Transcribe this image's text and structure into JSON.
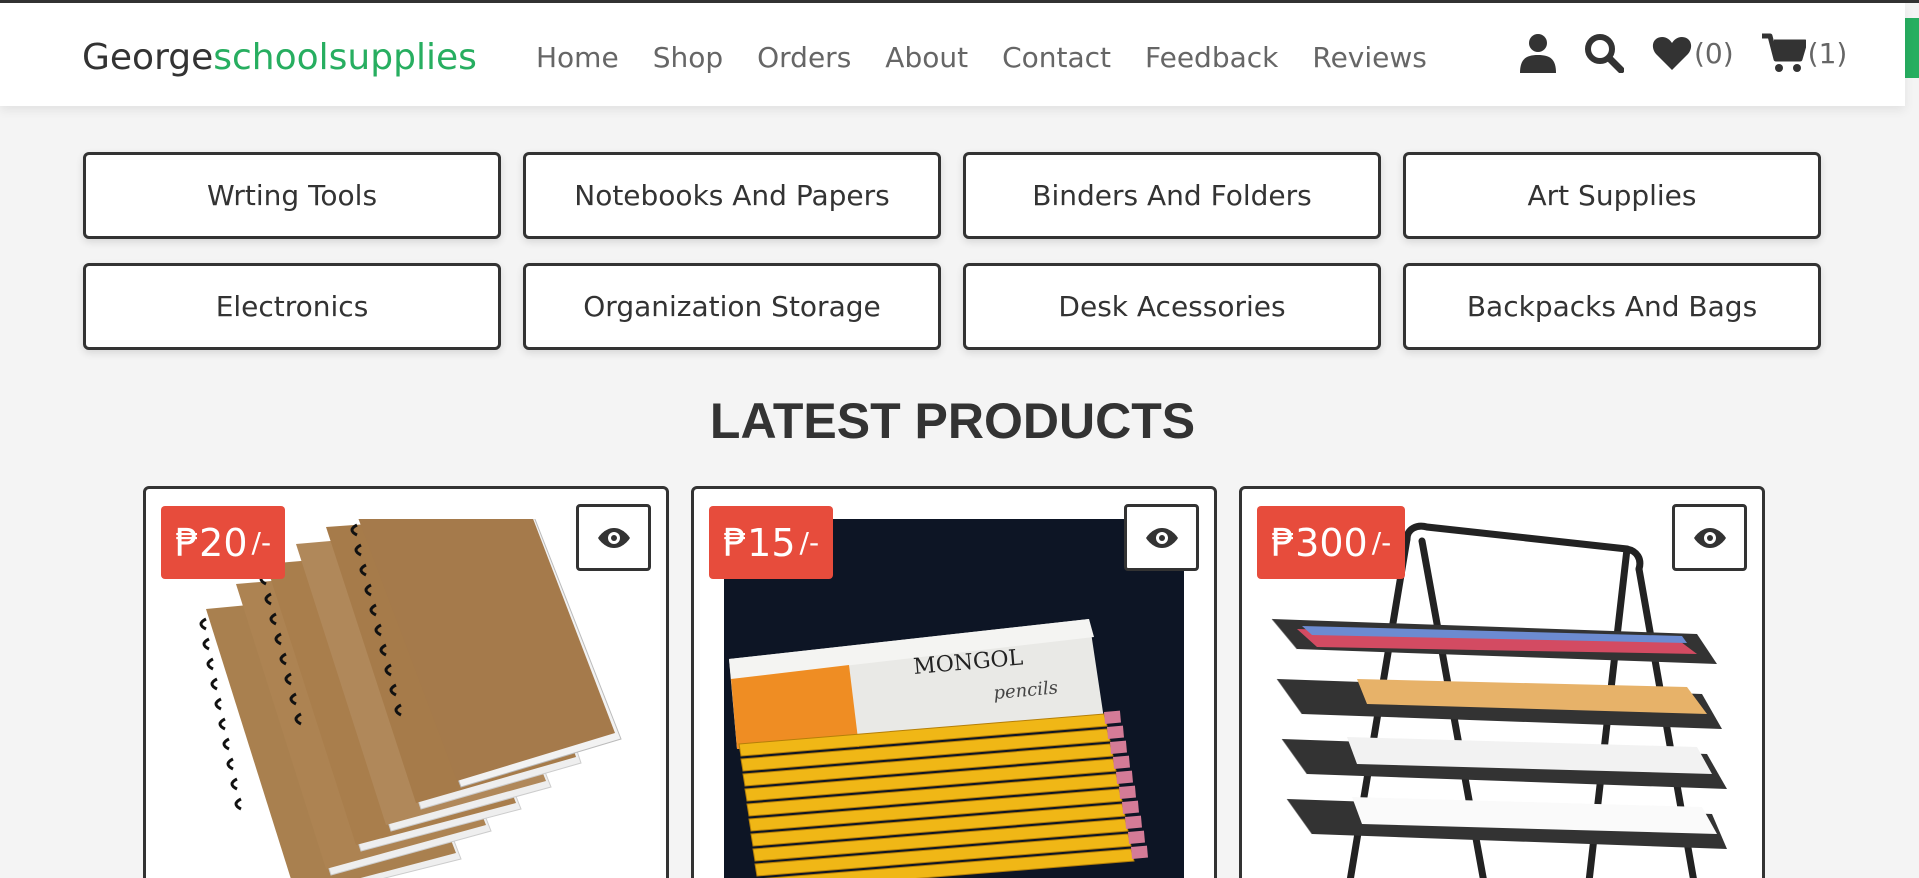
{
  "header": {
    "logo_primary": "George",
    "logo_accent": "schoolsupplies",
    "nav": [
      {
        "label": "Home"
      },
      {
        "label": "Shop"
      },
      {
        "label": "Orders"
      },
      {
        "label": "About"
      },
      {
        "label": "Contact"
      },
      {
        "label": "Feedback"
      },
      {
        "label": "Reviews"
      }
    ],
    "wishlist_count": "(0)",
    "cart_count": "(1)"
  },
  "categories": [
    {
      "label": "Wrting Tools"
    },
    {
      "label": "Notebooks And Papers"
    },
    {
      "label": "Binders And Folders"
    },
    {
      "label": "Art Supplies"
    },
    {
      "label": "Electronics"
    },
    {
      "label": "Organization Storage"
    },
    {
      "label": "Desk Acessories"
    },
    {
      "label": "Backpacks And Bags"
    }
  ],
  "section_title": "LATEST PRODUCTS",
  "products": [
    {
      "price": "₱20",
      "suffix": "/-",
      "image": "spiral-notebooks"
    },
    {
      "price": "₱15",
      "suffix": "/-",
      "image": "mongol-pencils",
      "box_brand": "MONGOL",
      "box_sub": "pencils"
    },
    {
      "price": "₱300",
      "suffix": "/-",
      "image": "mesh-desk-tray"
    }
  ],
  "colors": {
    "accent_green": "#27ae60",
    "price_red": "#e74c3c",
    "dark": "#333333",
    "background": "#f4f4f4"
  },
  "icons": [
    "user-icon",
    "search-icon",
    "heart-icon",
    "cart-icon",
    "eye-icon"
  ]
}
